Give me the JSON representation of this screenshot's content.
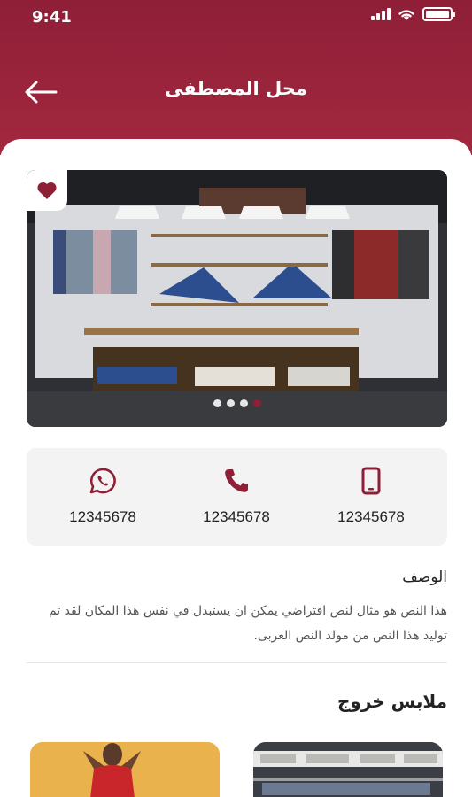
{
  "status_bar": {
    "time": "9:41"
  },
  "header": {
    "title": "محل المصطفى"
  },
  "gallery": {
    "slides": 4,
    "active_index": 3
  },
  "contacts": [
    {
      "icon": "whatsapp-icon",
      "number": "12345678"
    },
    {
      "icon": "phone-icon",
      "number": "12345678"
    },
    {
      "icon": "mobile-icon",
      "number": "12345678"
    }
  ],
  "description": {
    "title": "الوصف",
    "text": "هذا النص هو مثال لنص افتراضي يمكن ان يستبدل في نفس هذا المكان لقد تم توليد هذا النص من مولد النص العربى."
  },
  "section": {
    "title": "ملابس خروج"
  },
  "colors": {
    "brand": "#8e1f37",
    "card_bg": "#f3f3f3"
  }
}
